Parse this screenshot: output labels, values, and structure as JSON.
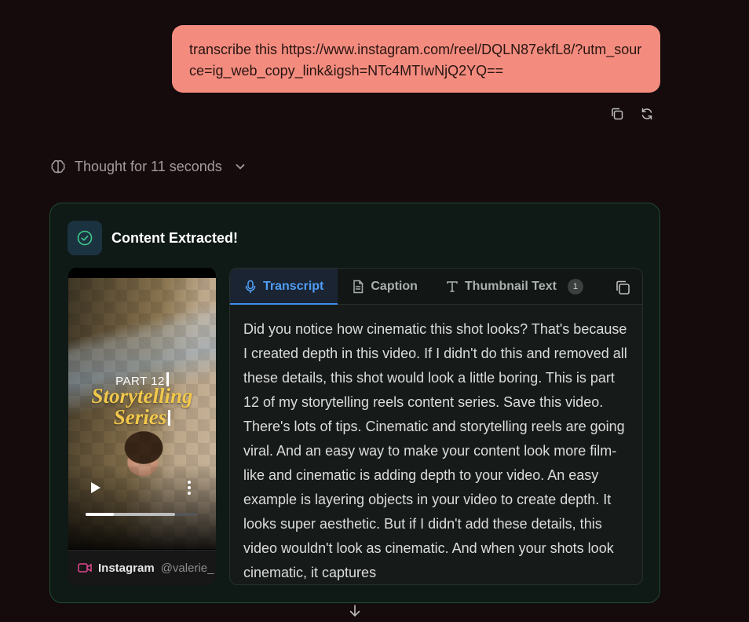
{
  "user_message": {
    "text": "transcribe this https://www.instagram.com/reel/DQLN87ekfL8/?utm_source=ig_web_copy_link&igsh=NTc4MTIwNjQ2YQ=="
  },
  "message_actions": [
    "copy-icon",
    "refresh-icon"
  ],
  "thought": {
    "label": "Thought for 11 seconds",
    "icon": "brain-icon"
  },
  "result_card": {
    "title": "Content Extracted!",
    "accent": "#1f4a35",
    "video": {
      "overlay_part": "PART 12",
      "overlay_line1": "Storytelling",
      "overlay_line2": "Series",
      "progress": 0.25,
      "buffered": 0.8,
      "source": "Instagram",
      "handle": "@valerie_"
    },
    "tabs": [
      {
        "label": "Transcript",
        "icon": "microphone-icon",
        "active": true
      },
      {
        "label": "Caption",
        "icon": "document-icon",
        "active": false
      },
      {
        "label": "Thumbnail Text",
        "icon": "text-icon",
        "active": false,
        "badge": "1"
      }
    ],
    "transcript": "Did you notice how cinematic this shot looks? That's because I created depth in this video. If I didn't do this and removed all these details, this shot would look a little boring. This is part 12 of my storytelling reels content series. Save this video. There's lots of tips. Cinematic and storytelling reels are going viral. And an easy way to make your content look more film-like and cinematic is adding depth to your video. An easy example is layering objects in your video to create depth. It looks super aesthetic. But if I didn't add these details, this video wouldn't look as cinematic. And when your shots look cinematic, it captures"
  }
}
